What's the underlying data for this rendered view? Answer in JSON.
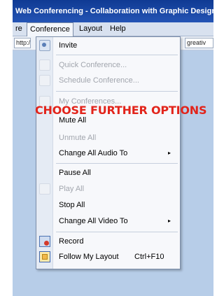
{
  "window": {
    "title": "Web Conferencing - Collaboration with Graphic Design"
  },
  "menu_bar": {
    "items": [
      {
        "label": "re"
      },
      {
        "label": "Conference"
      },
      {
        "label": "Layout"
      },
      {
        "label": "Help"
      }
    ]
  },
  "toolbar": {
    "address_left": "http:/",
    "address_right": "greativ"
  },
  "conference_menu": {
    "items": [
      {
        "label": "Invite",
        "icon": "invite-icon"
      },
      {
        "label": "Quick Conference...",
        "icon": "quick-conference-icon"
      },
      {
        "label": "Schedule Conference...",
        "icon": "schedule-conference-icon"
      },
      {
        "label": "My Conferences...",
        "icon": "my-conferences-icon"
      },
      {
        "label": "Mute All"
      },
      {
        "label": "Unmute All"
      },
      {
        "label": "Change All Audio To"
      },
      {
        "label": "Pause All"
      },
      {
        "label": "Play All",
        "icon": "play-all-icon"
      },
      {
        "label": "Stop All"
      },
      {
        "label": "Change All Video To"
      },
      {
        "label": "Record",
        "icon": "record-icon"
      },
      {
        "label": "Follow My Layout",
        "shortcut": "Ctrl+F10",
        "icon": "follow-layout-icon"
      }
    ],
    "submenu_arrow": "▸"
  },
  "overlay": {
    "caption": "CHOOSE FURTHER OPTIONS",
    "color": "#e2241b"
  },
  "colors": {
    "title_bar": "#0f3a93",
    "menu_bar": "#d8e1ef",
    "menu_background": "#f7f8fb",
    "disabled_text": "#a2a6ae"
  }
}
